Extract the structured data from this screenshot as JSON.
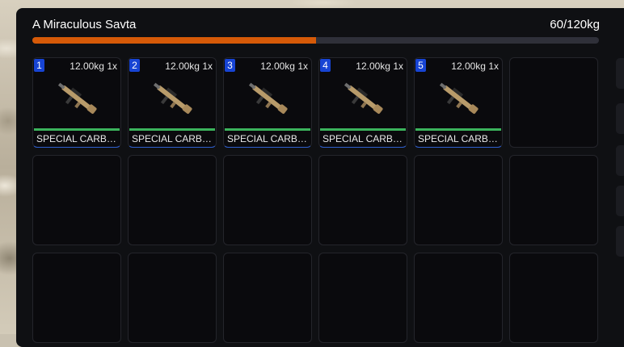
{
  "inventory": {
    "title": "A Miraculous Savta",
    "weight_text": "60/120kg",
    "weight_fraction": 0.5,
    "bar_color": "#d65a08",
    "slots": [
      {
        "number": "1",
        "weight_count": "12.00kg 1x",
        "label": "SPECIAL CARBINE",
        "icon": "rifle-icon"
      },
      {
        "number": "2",
        "weight_count": "12.00kg 1x",
        "label": "SPECIAL CARBINE",
        "icon": "rifle-icon"
      },
      {
        "number": "3",
        "weight_count": "12.00kg 1x",
        "label": "SPECIAL CARBINE",
        "icon": "rifle-icon"
      },
      {
        "number": "4",
        "weight_count": "12.00kg 1x",
        "label": "SPECIAL CARBINE",
        "icon": "rifle-icon"
      },
      {
        "number": "5",
        "weight_count": "12.00kg 1x",
        "label": "SPECIAL CARBINE",
        "icon": "rifle-icon"
      }
    ]
  }
}
